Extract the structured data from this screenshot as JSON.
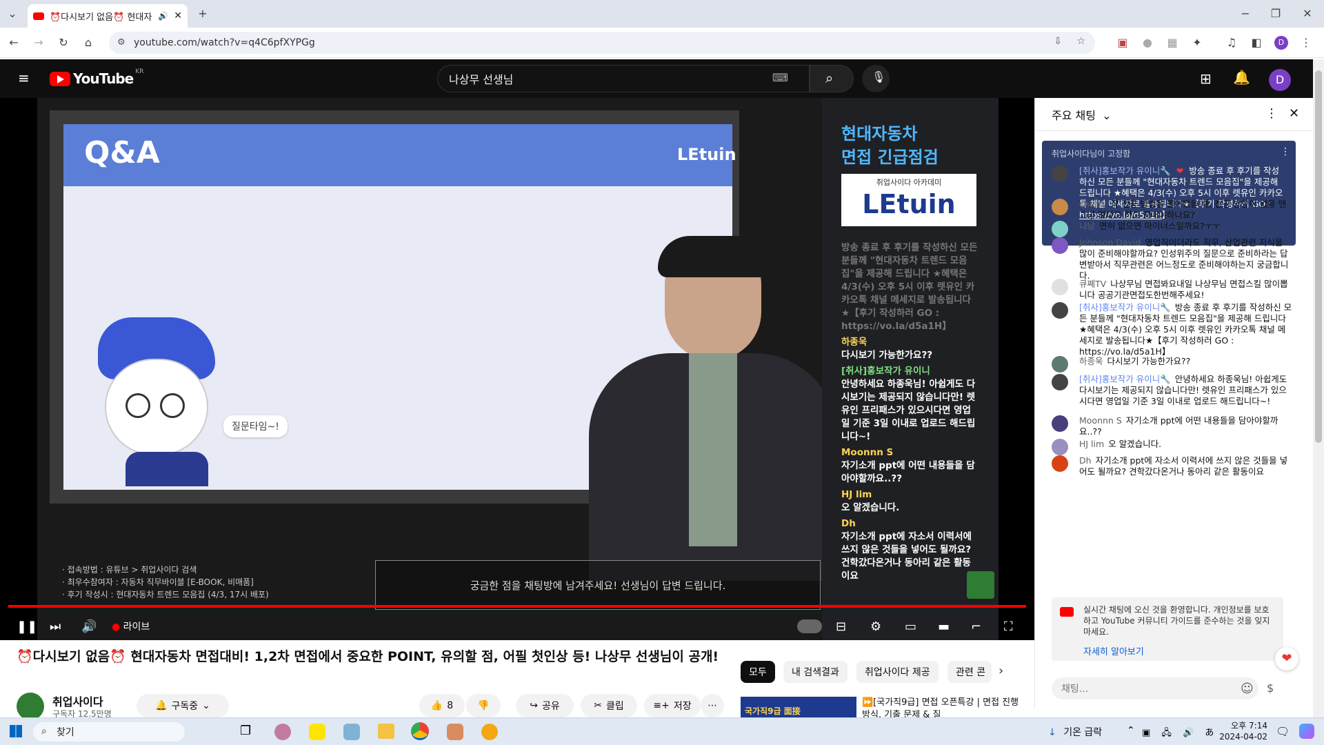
{
  "browser": {
    "tab_title": "⏰다시보기 없음⏰ 현대자",
    "url": "youtube.com/watch?v=q4C6pfXYPGg"
  },
  "youtube": {
    "logo_text": "YouTube",
    "country_code": "KR",
    "search_value": "나상무 선생님",
    "avatar_letter": "D"
  },
  "video": {
    "slide_title": "Q&A",
    "slide_brand": "LEtuin",
    "speech_bubble": "질문타임~!",
    "overlay_title_1": "현대자동차",
    "overlay_title_2": "면접 긴급점검",
    "overlay_logo_top": "취업사이다 아카데미",
    "overlay_logo": "LEtuin",
    "overlay_chat": [
      {
        "author": "",
        "text": "방송 종료 후 후기를 작성하신 모든 분들께 \"현대자동차 트렌드 모음집\"을 제공해 드립니다 ★혜택은 4/3(수) 오후 5시 이후 렛유인 카카오톡 채널 메세지로 발송됩니다★【후기 작성하러 GO : https://vo.la/d5a1H】"
      },
      {
        "author": "하종욱",
        "text": "다시보기 가능한가요??"
      },
      {
        "author": "[취사]홍보작가 유이니",
        "text": "안녕하세요 하종욱님! 아쉽게도 다시보기는 제공되지 않습니다만! 렛유인 프리패스가 있으시다면 영업일 기준 3일 이내로 업로드 해드립니다~!"
      },
      {
        "author": "Moonnn S",
        "text": "자기소개 ppt에 어떤 내용들을 담아야할까요..??"
      },
      {
        "author": "HJ lim",
        "text": "오 알겠습니다."
      },
      {
        "author": "Dh",
        "text": "자기소개 ppt에 자소서 이력서에 쓰지 않은 것들을 넣어도 될까요? 건학갔다온거나 동아리 같은 활동이요"
      }
    ],
    "info_lines": [
      "· 접속방법 : 유튜브 > 취업사이다 검색",
      "· 최우수참여자 : 자동차 직무바이블 [E-BOOK, 비매품]",
      "· 후기 작성시 : 현대자동차 트렌드 모음집 (4/3, 17시 배포)"
    ],
    "prompt": "궁금한 점을 채팅방에 남겨주세요! 선생님이 답변 드립니다.",
    "live_label": "라이브",
    "progress": 1.0
  },
  "below": {
    "title": "⏰다시보기 없음⏰ 현대자동차 면접대비! 1,2차 면접에서 중요한 POINT, 유의할 점, 어필 첫인상 등! 나상무 선생님이 공개!",
    "channel_name": "취업사이다",
    "subscribers": "구독자 12.5만명",
    "subscribe_label": "구독중",
    "like_count": "8",
    "share_label": "공유",
    "clip_label": "클립",
    "save_label": "저장",
    "chips": [
      "모두",
      "내 검색결과",
      "취업사이다 제공",
      "관련 콘"
    ],
    "rec_thumb_text": "국가직9급 面接",
    "rec_title": "⏩[국가직9급] 면접 오픈특강 | 면접 진행방식, 기출 문제 & 질"
  },
  "chat": {
    "header": "주요 채팅",
    "pinned_by": "취업사이다님이 고정함",
    "pinned_author": "[취사]홍보작가 유이니🔧",
    "pinned_text": "방송 종료 후 후기를 작성하신 모든 분들께 \"현대자동차 트렌드 모음집\"을 제공해 드립니다 ★혜택은 4/3(수) 오후 5시 이후 렛유인 카카오톡 채널 메세지로 발송됩니다★【후기 작성하러 GO : ",
    "pinned_link": "https://vo.la/d5a1H",
    "pinned_end": "】",
    "messages": [
      {
        "author": "cherry",
        "text": "작 전공 방법을 물어봤을 때, 전공 방향이 없을 땐 그냥 없다고 하고 끝내야하나요?",
        "mod": false,
        "color": "#c98a4a"
      },
      {
        "author": "나낭",
        "text": "면허 없으면 마이너스일까요?ㅜㅜ",
        "mod": false,
        "color": "#7fd1c7"
      },
      {
        "author": "Johnson David",
        "text": "영업직이더라도 직무, 산업관련 지식을 많이 준비해야할까요? 인성위주의 질문으로 준비하라는 답변받아서 직무관련은 어느정도로 준비해야하는지 궁금합니다.",
        "mod": false,
        "color": "#7e57c2"
      },
      {
        "author": "큐쩨TV",
        "text": "나상무님 면접봐요내일 나상무님 면접스킬 많이뽑니다 공공기관면접도한번해주세요!",
        "mod": false,
        "color": "#e0e0e0"
      },
      {
        "author": "[취사]홍보작가 유이니🔧",
        "text": "방송 종료 후 후기를 작성하신 모든 분들께 \"현대자동차 트렌드 모음집\"을 제공해 드립니다 ★혜택은 4/3(수) 오후 5시 이후 렛유인 카카오톡 채널 메세지로 발송됩니다★【후기 작성하러 GO : https://vo.la/d5a1H】",
        "mod": true,
        "color": "#444"
      },
      {
        "author": "하종욱",
        "text": "다시보기 가능한가요??",
        "mod": false,
        "color": "#5d7a6e"
      },
      {
        "author": "[취사]홍보작가 유이니🔧",
        "text": "안녕하세요 하종욱님! 아쉽게도 다시보기는 제공되지 않습니다만! 렛유인 프리패스가 있으시다면 영업일 기준 3일 이내로 업로드 해드립니다~!",
        "mod": true,
        "color": "#444"
      },
      {
        "author": "Moonnn S",
        "text": "자기소개 ppt에 어떤 내용들을 담아야할까요..??",
        "mod": false,
        "color": "#4a3f7a"
      },
      {
        "author": "HJ lim",
        "text": "오 알겠습니다.",
        "mod": false,
        "color": "#9a8fbf"
      },
      {
        "author": "Dh",
        "text": "자기소개 ppt에 자소서 이력서에 쓰지 않은 것들을 넣어도 될까요? 견학갔다온거나 동아리 같은 활동이요",
        "mod": false,
        "color": "#d84315"
      }
    ],
    "welcome_text": "실시간 채팅에 오신 것을 환영합니다. 개인정보를 보호하고 YouTube 커뮤니티 가이드를 준수하는 것을 잊지 마세요.",
    "learn_more": "자세히 알아보기",
    "input_placeholder": "채팅..."
  },
  "taskbar": {
    "search": "찾기",
    "weather": "기온 급락",
    "time": "오후 7:14",
    "date": "2024-04-02"
  }
}
